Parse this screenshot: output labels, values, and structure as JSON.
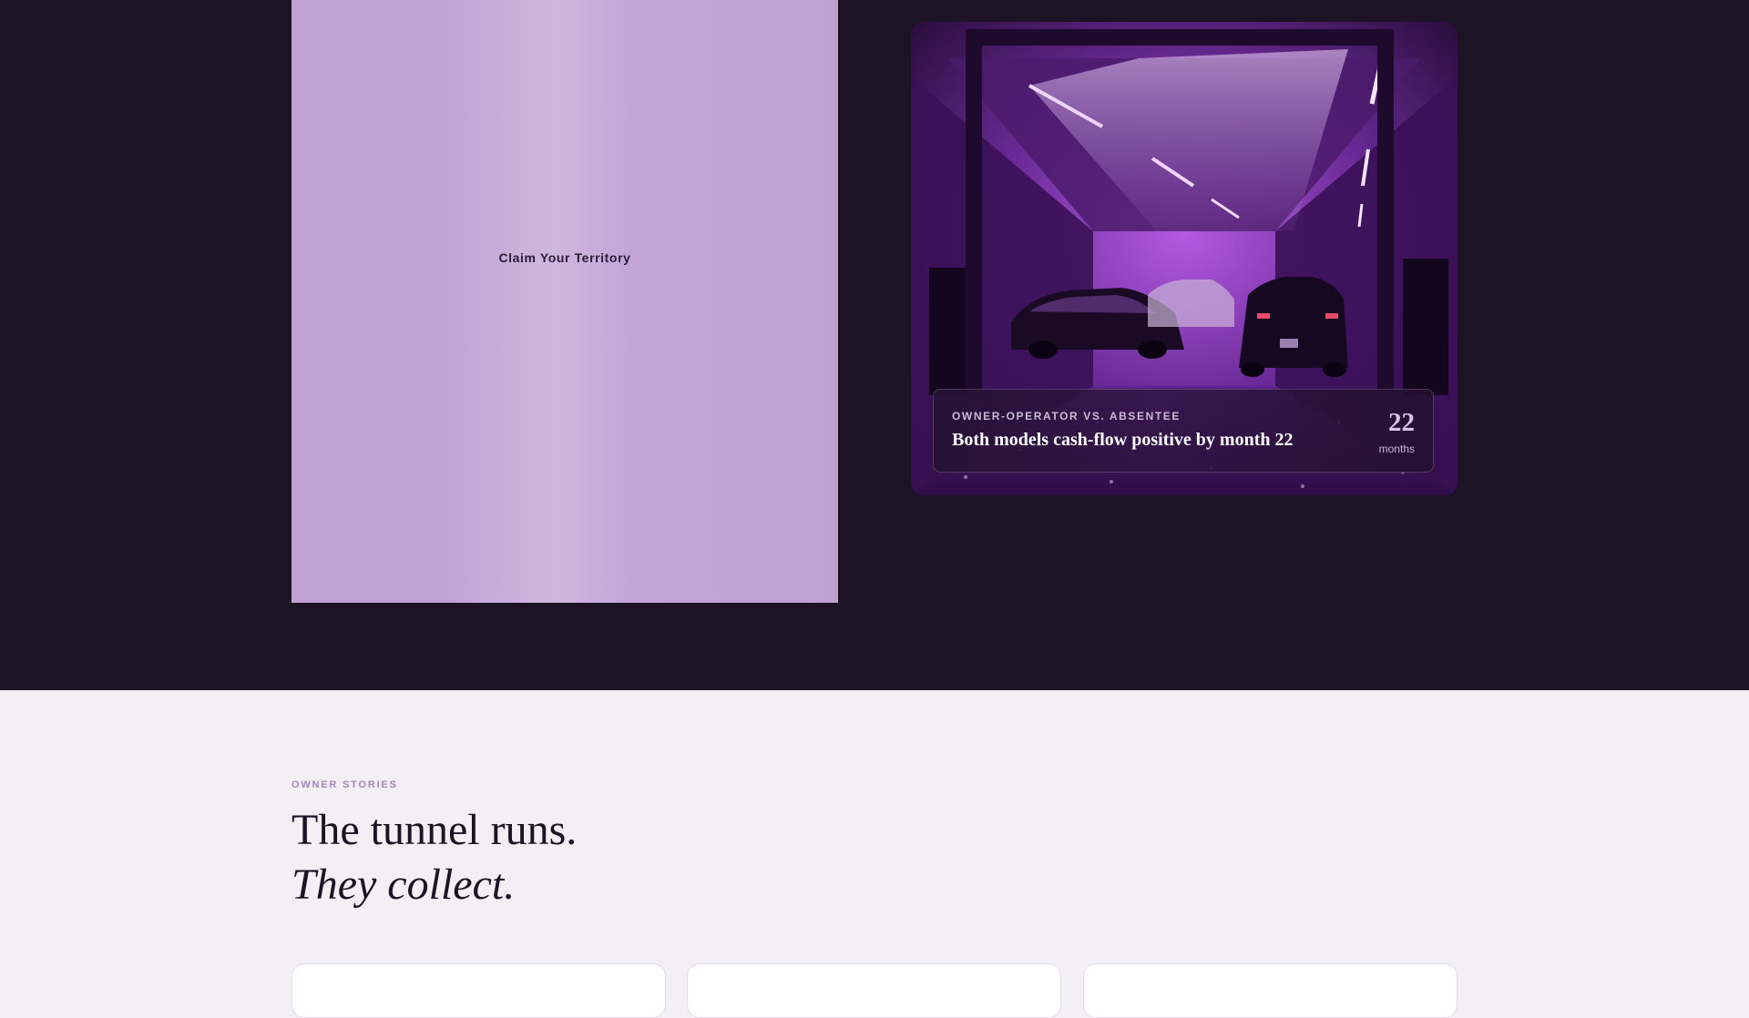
{
  "hero": {
    "cta_label": "Claim Your Territory",
    "photo_alt_icon": "car-wash-tunnel-photo",
    "stat_card": {
      "eyebrow": "OWNER-OPERATOR VS. ABSENTEE",
      "headline": "Both models cash-flow positive by month 22",
      "value": "22",
      "unit": "months"
    }
  },
  "stories": {
    "kicker": "OWNER STORIES",
    "title_line1": "The tunnel runs.",
    "title_line2": "They collect."
  },
  "colors": {
    "dark_bg": "#1c1424",
    "light_bg": "#f2eff5",
    "accent": "#a784bd",
    "cta_bg": "#c0a3d4"
  }
}
